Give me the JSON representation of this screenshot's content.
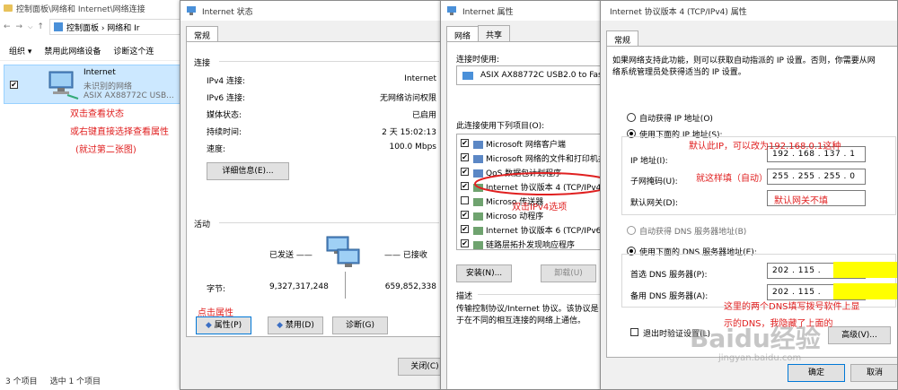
{
  "explorer": {
    "address_path": "控制面板 › 网络和 Ir",
    "address_segment_1": "控制面板",
    "address_segment_2": "网络和 Ir",
    "title": "控制面板\\网络和 Internet\\网络连接",
    "toolbar": {
      "organize": "组织 ▾",
      "disable": "禁用此网络设备",
      "diagnose": "诊断这个连"
    },
    "adapter": {
      "name": "Internet",
      "status": "未识别的网络",
      "device": "ASIX AX88772C USB..."
    },
    "status_bar": {
      "count": "3 个项目",
      "selected": "选中 1 个项目"
    }
  },
  "status_window": {
    "title": "Internet 状态",
    "tab": "常规",
    "connection_header": "连接",
    "rows": [
      {
        "label": "IPv4 连接:",
        "value": "Internet"
      },
      {
        "label": "IPv6 连接:",
        "value": "无网络访问权限"
      },
      {
        "label": "媒体状态:",
        "value": "已启用"
      },
      {
        "label": "持续时间:",
        "value": "2 天 15:02:13"
      },
      {
        "label": "速度:",
        "value": "100.0 Mbps"
      }
    ],
    "details_button": "详细信息(E)...",
    "activity_header": "活动",
    "sent_label": "已发送 ——",
    "received_label": "—— 已接收",
    "bytes_label": "字节:",
    "bytes_sent": "9,327,317,248",
    "bytes_received": "659,852,338",
    "properties_button": "属性(P)",
    "disable_button": "禁用(D)",
    "diagnose_button": "诊断(G)",
    "close_button": "关闭(C)"
  },
  "props_window": {
    "title": "Internet 属性",
    "tabs": [
      "网络",
      "共享"
    ],
    "connect_using_label": "连接时使用:",
    "adapter": "ASIX AX88772C USB2.0 to Fast",
    "items_label": "此连接使用下列项目(O):",
    "items": [
      {
        "label": "Microsoft 网络客户端",
        "checked": "✔"
      },
      {
        "label": "Microsoft 网络的文件和打印机共",
        "checked": "✔"
      },
      {
        "label": "QoS 数据包计划程序",
        "checked": "✔"
      },
      {
        "label": "Internet 协议版本 4 (TCP/IPv4)",
        "checked": "✔"
      },
      {
        "label": "Microso                    传送器",
        "checked": ""
      },
      {
        "label": "Microso                  动程序",
        "checked": "✔"
      },
      {
        "label": "Internet 协议版本 6 (TCP/IPv6)",
        "checked": "✔"
      },
      {
        "label": "链路层拓扑发现响应程序",
        "checked": "✔"
      }
    ],
    "install_button": "安装(N)...",
    "uninstall_button": "卸载(U)",
    "description_header": "描述",
    "description": "传输控制协议/Internet 协议。该协议是\n于在不同的相互连接的网络上通信。"
  },
  "ipv4_window": {
    "title": "Internet 协议版本 4 (TCP/IPv4) 属性",
    "tab": "常规",
    "intro": "如果网络支持此功能，则可以获取自动指派的 IP 设置。否则，你需要从网\n络系统管理员处获得适当的 IP 设置。",
    "auto_ip": "自动获得 IP 地址(O)",
    "manual_ip": "使用下面的 IP 地址(S):",
    "ip_label": "IP 地址(I):",
    "ip_value": "192 . 168 . 137 . 1",
    "mask_label": "子网掩码(U):",
    "mask_value": "255 . 255 . 255 . 0",
    "gateway_label": "默认网关(D):",
    "auto_dns": "自动获得 DNS 服务器地址(B)",
    "manual_dns": "使用下面的 DNS 服务器地址(E):",
    "preferred_dns_label": "首选 DNS 服务器(P):",
    "preferred_dns_value": "202 . 115 .",
    "alternate_dns_label": "备用 DNS 服务器(A):",
    "alternate_dns_value": "202 . 115 .",
    "validate_label": "退出时验证设置(L)",
    "advanced_button": "高级(V)...",
    "ok_button": "确定",
    "cancel_button": "取消"
  },
  "annotations": {
    "double_click_status": "双击查看状态",
    "right_click": "或右键直接选择查看属性",
    "skip": "(就过第二张图)",
    "click_properties": "点击属性",
    "double_click_ipv4": "双击IPv4选项",
    "default_ip": "默认此IP，可以改为192.168.0.1这种",
    "mask_note": "就这样填（自动）",
    "gateway_note": "默认网关不填",
    "dns_note_1": "这里的两个DNS填写拨号软件上显",
    "dns_note_2": "示的DNS，我隐藏了上面的"
  },
  "watermark": {
    "brand": "Baidu经验",
    "url": "jingyan.baidu.com"
  },
  "colors": {
    "annotation": "#e02020",
    "highlight": "#ffff00",
    "selection": "#cce8ff",
    "accent": "#0078d7"
  }
}
